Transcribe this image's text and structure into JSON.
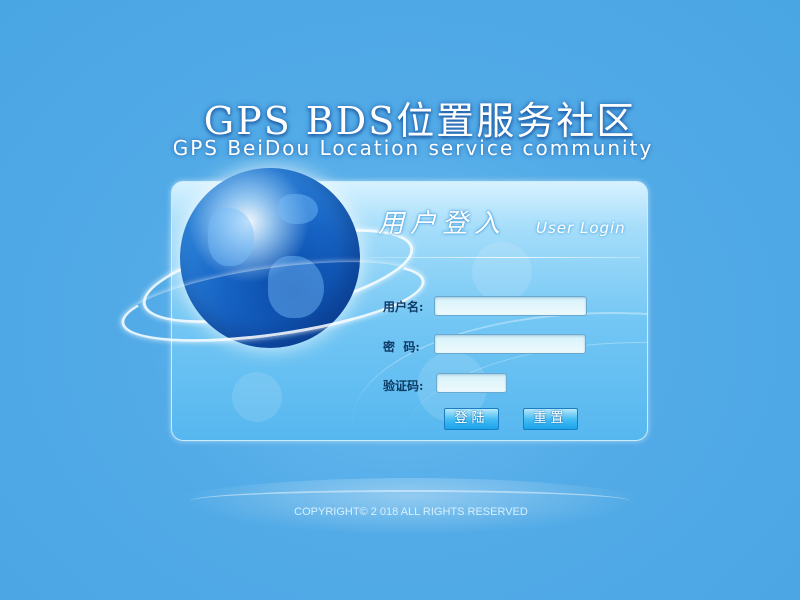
{
  "header": {
    "title": "GPS BDS位置服务社区",
    "subtitle": "GPS BeiDou Location service community"
  },
  "login": {
    "title_cn": "用户登入",
    "title_en": "User Login",
    "username_label": "用户名:",
    "password_label": "密  码:",
    "captcha_label": "验证码:",
    "username_value": "",
    "password_value": "",
    "captcha_value": "",
    "login_button": "登陆",
    "reset_button": "重置"
  },
  "footer": {
    "copyright": "COPYRIGHT© 2 018 ALL RIGHTS RESERVED"
  },
  "colors": {
    "background": "#4fa9e6",
    "panel_border": "#c9ecff",
    "button_blue": "#1aa3ec",
    "label_text": "#0e3a66"
  },
  "icons": {
    "globe": "globe-icon"
  }
}
